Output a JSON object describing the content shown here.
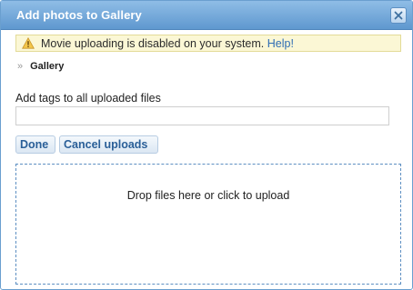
{
  "dialog": {
    "title": "Add photos to Gallery",
    "close_icon": "close-icon"
  },
  "warning": {
    "icon": "warning-icon",
    "message": "Movie uploading is disabled on your system.",
    "link": "Help!"
  },
  "breadcrumb": {
    "arrow": "»",
    "item": "Gallery"
  },
  "tags": {
    "label": "Add tags to all uploaded files",
    "value": ""
  },
  "buttons": {
    "done": "Done",
    "cancel": "Cancel uploads"
  },
  "dropzone": {
    "text": "Drop files here or click to upload"
  },
  "colors": {
    "titlebar": "#5f98cf",
    "link": "#2f6db4",
    "warning_bg": "#fbf7d5",
    "dropzone_border": "#5d8fc2"
  }
}
